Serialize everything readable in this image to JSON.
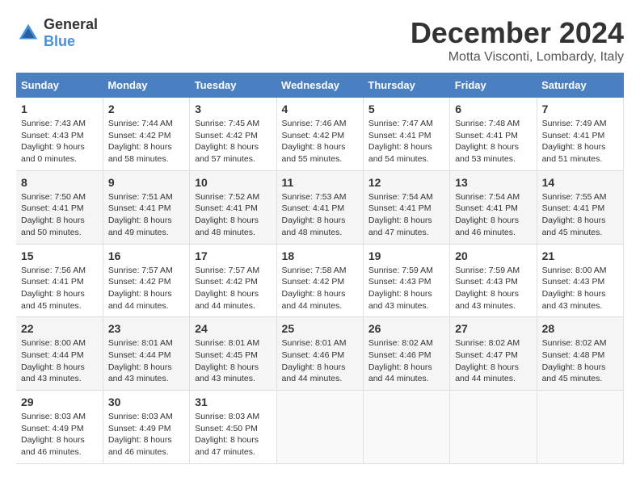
{
  "logo": {
    "text_general": "General",
    "text_blue": "Blue"
  },
  "title": {
    "month": "December 2024",
    "location": "Motta Visconti, Lombardy, Italy"
  },
  "weekdays": [
    "Sunday",
    "Monday",
    "Tuesday",
    "Wednesday",
    "Thursday",
    "Friday",
    "Saturday"
  ],
  "weeks": [
    [
      {
        "day": "1",
        "sunrise": "Sunrise: 7:43 AM",
        "sunset": "Sunset: 4:43 PM",
        "daylight": "Daylight: 9 hours and 0 minutes."
      },
      {
        "day": "2",
        "sunrise": "Sunrise: 7:44 AM",
        "sunset": "Sunset: 4:42 PM",
        "daylight": "Daylight: 8 hours and 58 minutes."
      },
      {
        "day": "3",
        "sunrise": "Sunrise: 7:45 AM",
        "sunset": "Sunset: 4:42 PM",
        "daylight": "Daylight: 8 hours and 57 minutes."
      },
      {
        "day": "4",
        "sunrise": "Sunrise: 7:46 AM",
        "sunset": "Sunset: 4:42 PM",
        "daylight": "Daylight: 8 hours and 55 minutes."
      },
      {
        "day": "5",
        "sunrise": "Sunrise: 7:47 AM",
        "sunset": "Sunset: 4:41 PM",
        "daylight": "Daylight: 8 hours and 54 minutes."
      },
      {
        "day": "6",
        "sunrise": "Sunrise: 7:48 AM",
        "sunset": "Sunset: 4:41 PM",
        "daylight": "Daylight: 8 hours and 53 minutes."
      },
      {
        "day": "7",
        "sunrise": "Sunrise: 7:49 AM",
        "sunset": "Sunset: 4:41 PM",
        "daylight": "Daylight: 8 hours and 51 minutes."
      }
    ],
    [
      {
        "day": "8",
        "sunrise": "Sunrise: 7:50 AM",
        "sunset": "Sunset: 4:41 PM",
        "daylight": "Daylight: 8 hours and 50 minutes."
      },
      {
        "day": "9",
        "sunrise": "Sunrise: 7:51 AM",
        "sunset": "Sunset: 4:41 PM",
        "daylight": "Daylight: 8 hours and 49 minutes."
      },
      {
        "day": "10",
        "sunrise": "Sunrise: 7:52 AM",
        "sunset": "Sunset: 4:41 PM",
        "daylight": "Daylight: 8 hours and 48 minutes."
      },
      {
        "day": "11",
        "sunrise": "Sunrise: 7:53 AM",
        "sunset": "Sunset: 4:41 PM",
        "daylight": "Daylight: 8 hours and 48 minutes."
      },
      {
        "day": "12",
        "sunrise": "Sunrise: 7:54 AM",
        "sunset": "Sunset: 4:41 PM",
        "daylight": "Daylight: 8 hours and 47 minutes."
      },
      {
        "day": "13",
        "sunrise": "Sunrise: 7:54 AM",
        "sunset": "Sunset: 4:41 PM",
        "daylight": "Daylight: 8 hours and 46 minutes."
      },
      {
        "day": "14",
        "sunrise": "Sunrise: 7:55 AM",
        "sunset": "Sunset: 4:41 PM",
        "daylight": "Daylight: 8 hours and 45 minutes."
      }
    ],
    [
      {
        "day": "15",
        "sunrise": "Sunrise: 7:56 AM",
        "sunset": "Sunset: 4:41 PM",
        "daylight": "Daylight: 8 hours and 45 minutes."
      },
      {
        "day": "16",
        "sunrise": "Sunrise: 7:57 AM",
        "sunset": "Sunset: 4:42 PM",
        "daylight": "Daylight: 8 hours and 44 minutes."
      },
      {
        "day": "17",
        "sunrise": "Sunrise: 7:57 AM",
        "sunset": "Sunset: 4:42 PM",
        "daylight": "Daylight: 8 hours and 44 minutes."
      },
      {
        "day": "18",
        "sunrise": "Sunrise: 7:58 AM",
        "sunset": "Sunset: 4:42 PM",
        "daylight": "Daylight: 8 hours and 44 minutes."
      },
      {
        "day": "19",
        "sunrise": "Sunrise: 7:59 AM",
        "sunset": "Sunset: 4:43 PM",
        "daylight": "Daylight: 8 hours and 43 minutes."
      },
      {
        "day": "20",
        "sunrise": "Sunrise: 7:59 AM",
        "sunset": "Sunset: 4:43 PM",
        "daylight": "Daylight: 8 hours and 43 minutes."
      },
      {
        "day": "21",
        "sunrise": "Sunrise: 8:00 AM",
        "sunset": "Sunset: 4:43 PM",
        "daylight": "Daylight: 8 hours and 43 minutes."
      }
    ],
    [
      {
        "day": "22",
        "sunrise": "Sunrise: 8:00 AM",
        "sunset": "Sunset: 4:44 PM",
        "daylight": "Daylight: 8 hours and 43 minutes."
      },
      {
        "day": "23",
        "sunrise": "Sunrise: 8:01 AM",
        "sunset": "Sunset: 4:44 PM",
        "daylight": "Daylight: 8 hours and 43 minutes."
      },
      {
        "day": "24",
        "sunrise": "Sunrise: 8:01 AM",
        "sunset": "Sunset: 4:45 PM",
        "daylight": "Daylight: 8 hours and 43 minutes."
      },
      {
        "day": "25",
        "sunrise": "Sunrise: 8:01 AM",
        "sunset": "Sunset: 4:46 PM",
        "daylight": "Daylight: 8 hours and 44 minutes."
      },
      {
        "day": "26",
        "sunrise": "Sunrise: 8:02 AM",
        "sunset": "Sunset: 4:46 PM",
        "daylight": "Daylight: 8 hours and 44 minutes."
      },
      {
        "day": "27",
        "sunrise": "Sunrise: 8:02 AM",
        "sunset": "Sunset: 4:47 PM",
        "daylight": "Daylight: 8 hours and 44 minutes."
      },
      {
        "day": "28",
        "sunrise": "Sunrise: 8:02 AM",
        "sunset": "Sunset: 4:48 PM",
        "daylight": "Daylight: 8 hours and 45 minutes."
      }
    ],
    [
      {
        "day": "29",
        "sunrise": "Sunrise: 8:03 AM",
        "sunset": "Sunset: 4:49 PM",
        "daylight": "Daylight: 8 hours and 46 minutes."
      },
      {
        "day": "30",
        "sunrise": "Sunrise: 8:03 AM",
        "sunset": "Sunset: 4:49 PM",
        "daylight": "Daylight: 8 hours and 46 minutes."
      },
      {
        "day": "31",
        "sunrise": "Sunrise: 8:03 AM",
        "sunset": "Sunset: 4:50 PM",
        "daylight": "Daylight: 8 hours and 47 minutes."
      },
      null,
      null,
      null,
      null
    ]
  ]
}
